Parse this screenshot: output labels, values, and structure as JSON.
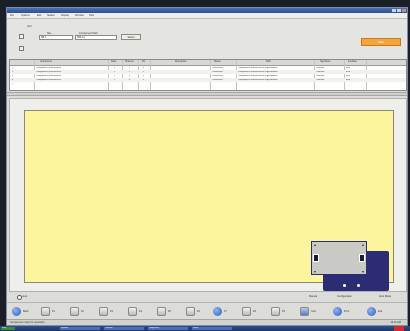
{
  "window": {
    "title": ""
  },
  "menu": [
    "File",
    "Options",
    "Edit",
    "Station",
    "Display",
    "Window",
    "Help"
  ],
  "filter": {
    "label_top": "Unit",
    "label_site": "Site",
    "label_path": "Component Path",
    "site_value": "SB 1",
    "path_value": "SRLA+",
    "search_button": "Select",
    "action_button": "Start"
  },
  "table": {
    "columns": [
      "",
      "Component",
      "Node",
      "Channel",
      "I/O",
      "Description",
      "Status",
      "Path",
      "Tag Name",
      "Interface"
    ],
    "rows": [
      [
        "1",
        "Component/Terminal/IRIS",
        "1",
        "1",
        "0",
        "",
        "Connected",
        "Component/Terminal/IRIS/Plugin/Module",
        "Terminal",
        "IRIS"
      ],
      [
        "2",
        "Component/Terminal/IRIS",
        "1",
        "2",
        "0",
        "",
        "Connected",
        "Component/Terminal/IRIS/Plugin/Module",
        "Terminal",
        "IRIS"
      ],
      [
        "3",
        "Component/Terminal/IRIS",
        "1",
        "3",
        "0",
        "",
        "Connected",
        "Component/Terminal/IRIS/Plugin/Module",
        "Terminal",
        "IRIS"
      ],
      [
        "4",
        "Component/Terminal/IRIS",
        "1",
        "4",
        "0",
        "",
        "Connected",
        "Component/Terminal/IRIS/Plugin/Module",
        "Terminal",
        "IRIS"
      ],
      [
        "5",
        "",
        "",
        "",
        "",
        "",
        "",
        "",
        "",
        ""
      ]
    ]
  },
  "status_row": {
    "left_label": "Auto",
    "r1": "Manual",
    "r2": "Configuration",
    "r3": "Auto Mode"
  },
  "toolbar": [
    {
      "icon": "back-icon",
      "label": "Back"
    },
    {
      "icon": "f1-icon",
      "label": "F1"
    },
    {
      "icon": "f2-icon",
      "label": "F2"
    },
    {
      "icon": "f3-icon",
      "label": "F3"
    },
    {
      "icon": "f4-icon",
      "label": "F4"
    },
    {
      "icon": "f5-icon",
      "label": "F5"
    },
    {
      "icon": "f6-icon",
      "label": "F6"
    },
    {
      "icon": "help-icon",
      "label": "F7"
    },
    {
      "icon": "f8-icon",
      "label": "F8"
    },
    {
      "icon": "f9-icon",
      "label": "F9"
    },
    {
      "icon": "grid-icon",
      "label": "Grid"
    },
    {
      "icon": "print-icon",
      "label": "Print"
    },
    {
      "icon": "exit-icon",
      "label": "Exit"
    }
  ],
  "statusbar": {
    "left": "Component ready for operation",
    "right": "10:42 AM"
  },
  "taskbar": [
    "Start",
    "Explorer",
    "Terminal",
    "Diagnostics",
    "Setup"
  ]
}
